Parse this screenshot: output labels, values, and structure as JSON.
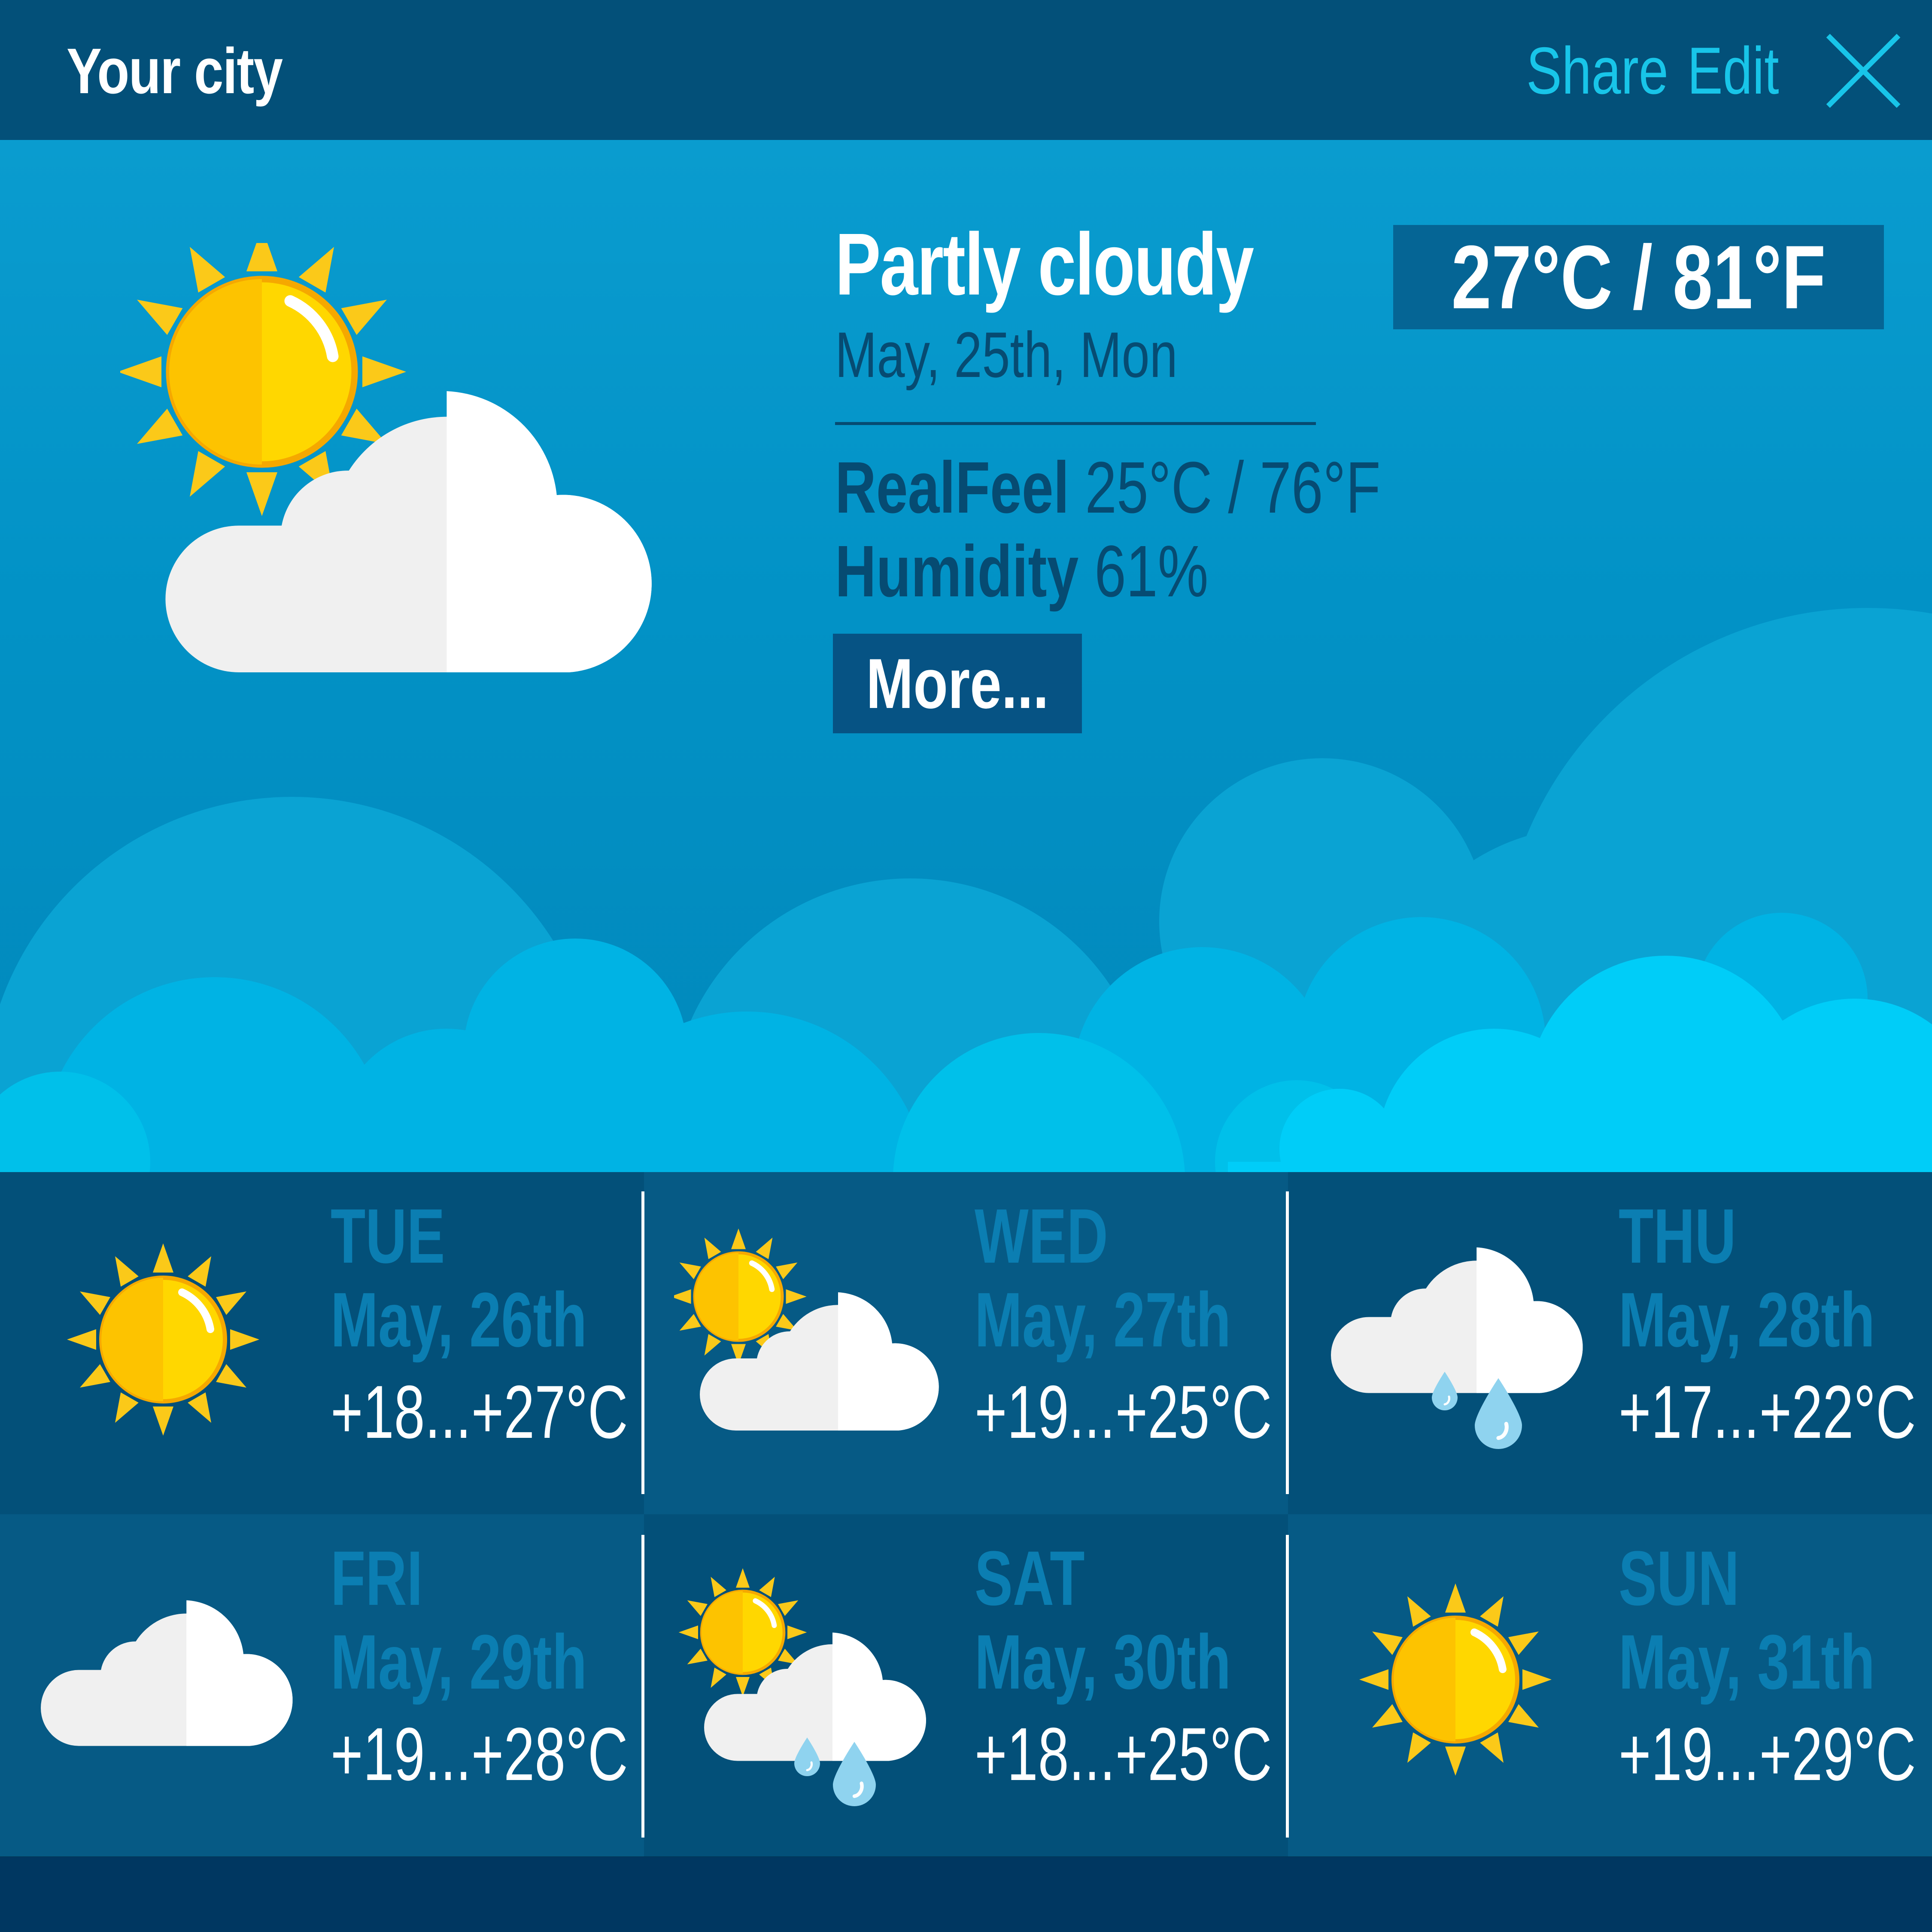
{
  "header": {
    "city": "Your city",
    "share_label": "Share",
    "edit_label": "Edit",
    "close_icon": "close-icon"
  },
  "current": {
    "condition": "Partly cloudy",
    "date": "May, 25th, Mon",
    "realfeel_label": "RealFeel",
    "realfeel_value": "25°C / 76°F",
    "humidity_label": "Humidity",
    "humidity_value": "61%",
    "more_label": "More...",
    "temperature": "27°C / 81°F",
    "icon": "partly-cloudy-icon"
  },
  "forecast": [
    {
      "day": "TUE",
      "date": "May, 26th",
      "range": "+18...+27°C",
      "icon": "sun-icon"
    },
    {
      "day": "WED",
      "date": "May, 27th",
      "range": "+19...+25°C",
      "icon": "partly-cloudy-icon"
    },
    {
      "day": "THU",
      "date": "May, 28th",
      "range": "+17...+22°C",
      "icon": "rain-cloud-icon"
    },
    {
      "day": "FRI",
      "date": "May, 29th",
      "range": "+19...+28°C",
      "icon": "cloud-icon"
    },
    {
      "day": "SAT",
      "date": "May, 30th",
      "range": "+18...+25°C",
      "icon": "partly-cloudy-rain-icon"
    },
    {
      "day": "SUN",
      "date": "May, 31th",
      "range": "+19...+29°C",
      "icon": "sun-icon"
    }
  ],
  "colors": {
    "header": "#035079",
    "accent": "#18c5e9",
    "sky": "#0292c6",
    "dark_text": "#064b72",
    "day_text": "#0b7eb2",
    "sun": "#ffd700",
    "cloud": "#f0f0f0"
  }
}
